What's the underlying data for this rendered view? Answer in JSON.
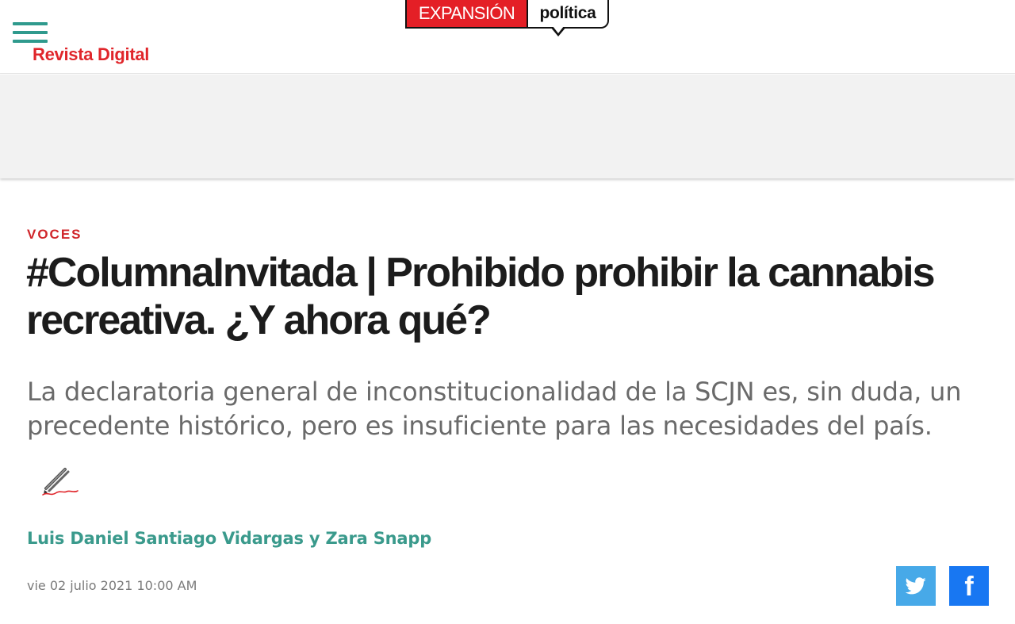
{
  "header": {
    "menu_icon": "hamburger-menu-icon",
    "revista_label": "Revista Digital",
    "logo": {
      "brand": "EXPANSIÓN",
      "section": "política"
    }
  },
  "article": {
    "kicker": "VOCES",
    "title": "#ColumnaInvitada | Prohibido prohibir la cannabis recreativa. ¿Y ahora qué?",
    "subtitle": "La declaratoria general de inconstitucionalidad de la SCJN es, sin duda, un precedente histórico, pero es insuficiente para las necesidades del país.",
    "author_icon": "pen-signature-icon",
    "author": "Luis Daniel Santiago Vidargas y Zara Snapp",
    "date": "vie 02 julio 2021 10:00 AM"
  },
  "share": {
    "twitter_icon": "twitter-icon",
    "facebook_icon": "facebook-icon",
    "facebook_glyph": "f"
  },
  "colors": {
    "accent_red": "#e0262b",
    "accent_teal": "#3a9a8c",
    "twitter": "#47a9e8",
    "facebook": "#1877f2"
  }
}
